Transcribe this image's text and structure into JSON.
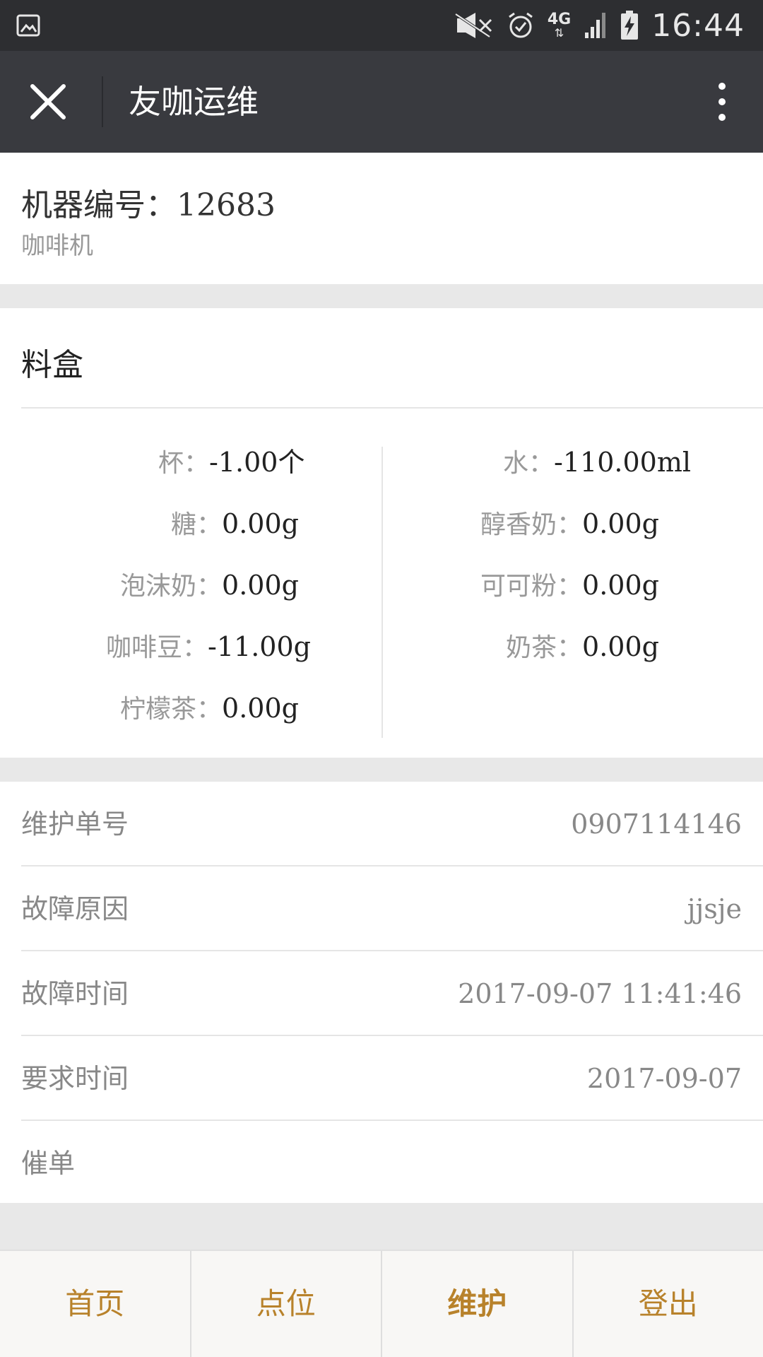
{
  "status_bar": {
    "time": "16:44",
    "network": "4G",
    "icons": [
      "gallery-icon",
      "mute-icon",
      "alarm-icon",
      "network-4g-icon",
      "signal-icon",
      "battery-charging-icon"
    ]
  },
  "nav": {
    "title": "友咖运维",
    "close_icon": "close-icon",
    "more_icon": "more-vertical-icon"
  },
  "machine": {
    "title": "机器编号：12683",
    "subtitle": "咖啡机"
  },
  "box": {
    "title": "料盒",
    "left": [
      {
        "label": "杯",
        "value": "-1.00个"
      },
      {
        "label": "糖",
        "value": "0.00g"
      },
      {
        "label": "泡沫奶",
        "value": "0.00g"
      },
      {
        "label": "咖啡豆",
        "value": "-11.00g"
      },
      {
        "label": "柠檬茶",
        "value": "0.00g"
      }
    ],
    "right": [
      {
        "label": "水",
        "value": "-110.00ml"
      },
      {
        "label": "醇香奶",
        "value": "0.00g"
      },
      {
        "label": "可可粉",
        "value": "0.00g"
      },
      {
        "label": "奶茶",
        "value": "0.00g"
      }
    ],
    "separator": "："
  },
  "info": {
    "rows": [
      {
        "label": "维护单号",
        "value": "0907114146"
      },
      {
        "label": "故障原因",
        "value": "jjsje"
      },
      {
        "label": "故障时间",
        "value": "2017-09-07 11:41:46"
      },
      {
        "label": "要求时间",
        "value": "2017-09-07"
      },
      {
        "label": "催单",
        "value": ""
      }
    ]
  },
  "tabs": [
    {
      "label": "首页",
      "active": false
    },
    {
      "label": "点位",
      "active": false
    },
    {
      "label": "维护",
      "active": true
    },
    {
      "label": "登出",
      "active": false
    }
  ],
  "colors": {
    "nav_bg": "#393a3f",
    "status_bg": "#2d2e31",
    "tab_text": "#b8822b"
  }
}
